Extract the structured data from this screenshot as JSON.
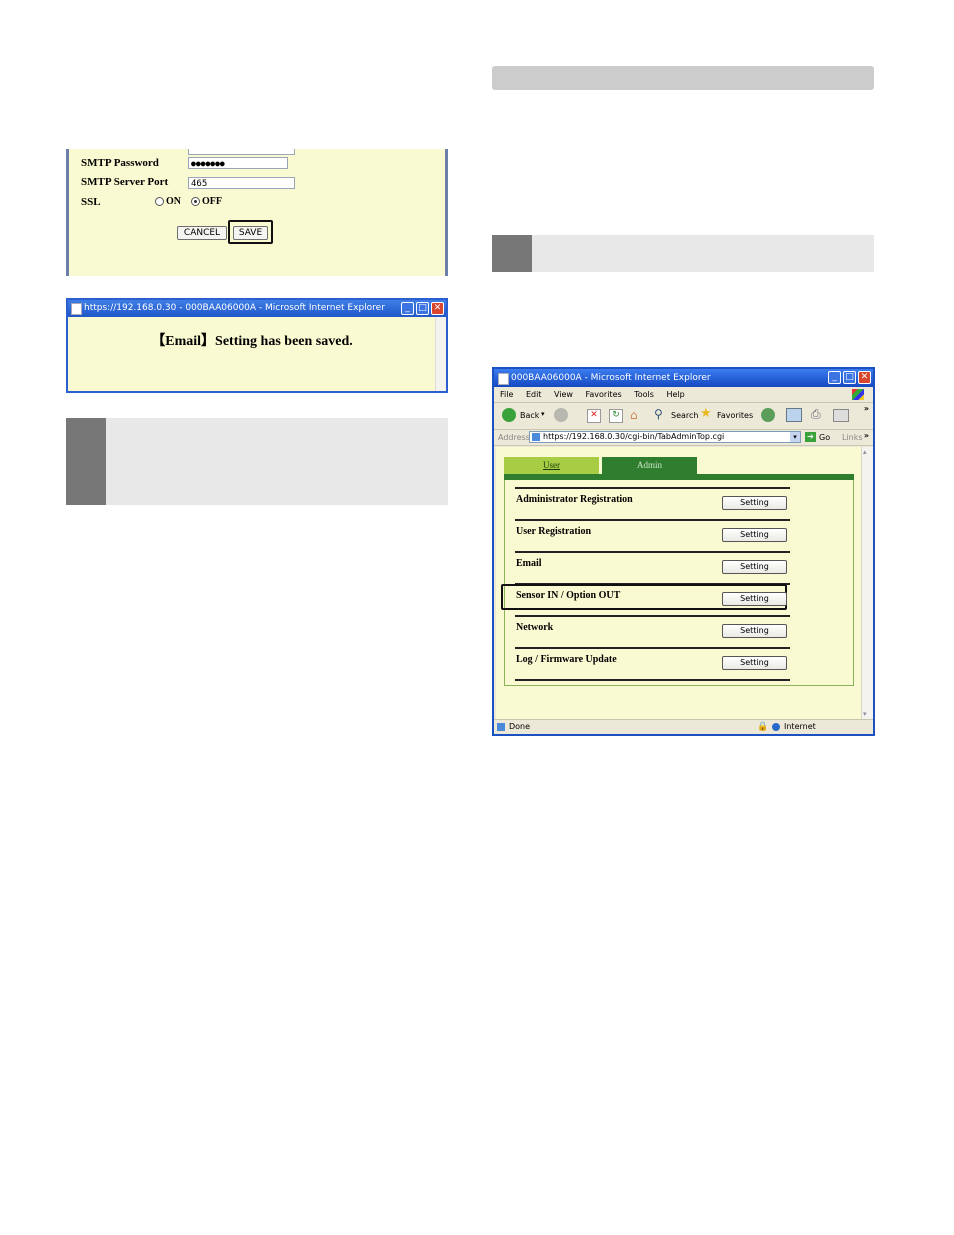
{
  "smtp_panel": {
    "password_label": "SMTP Password",
    "password_value": "●●●●●●●",
    "port_label": "SMTP Server Port",
    "port_value": "465",
    "ssl_label": "SSL",
    "ssl_on": "ON",
    "ssl_off": "OFF",
    "cancel_label": "CANCEL",
    "save_label": "SAVE"
  },
  "saved_dialog": {
    "title": "https://192.168.0.30 - 000BAA06000A - Microsoft Internet Explorer",
    "message": "【Email】Setting has been saved."
  },
  "ie": {
    "title": "000BAA06000A - Microsoft Internet Explorer",
    "menu": [
      "File",
      "Edit",
      "View",
      "Favorites",
      "Tools",
      "Help"
    ],
    "toolbar": {
      "back": "Back",
      "search": "Search",
      "favorites": "Favorites"
    },
    "address_label": "Address",
    "url": "https://192.168.0.30/cgi-bin/TabAdminTop.cgi",
    "go": "Go",
    "links": "Links",
    "tabs": {
      "user": "User",
      "admin": "Admin"
    },
    "rows": [
      {
        "label": "Administrator Registration",
        "button": "Setting"
      },
      {
        "label": "User Registration",
        "button": "Setting"
      },
      {
        "label": "Email",
        "button": "Setting"
      },
      {
        "label": "Sensor IN / Option OUT",
        "button": "Setting"
      },
      {
        "label": "Network",
        "button": "Setting"
      },
      {
        "label": "Log / Firmware Update",
        "button": "Setting"
      }
    ],
    "status_done": "Done",
    "status_zone": "Internet"
  }
}
